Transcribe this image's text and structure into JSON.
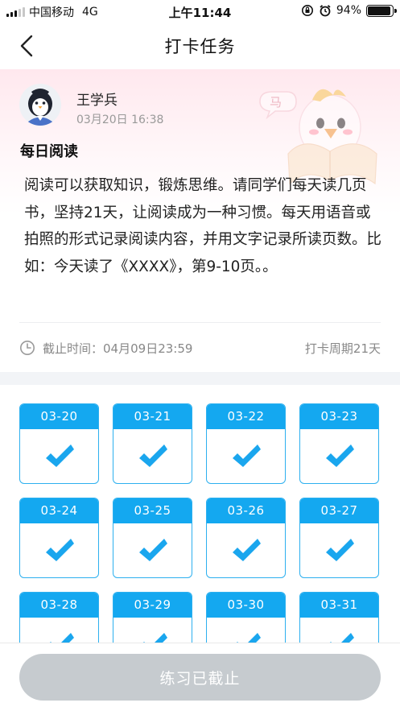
{
  "status_bar": {
    "carrier": "中国移动",
    "network": "4G",
    "time": "上午11:44",
    "battery_text": "94%",
    "battery_level": 0.94
  },
  "nav": {
    "title": "打卡任务",
    "back_icon": "chevron-left-icon"
  },
  "task": {
    "author": "王学兵",
    "post_time": "03月20日 16:38",
    "title": "每日阅读",
    "description": "阅读可以获取知识，锻炼思维。请同学们每天读几页书，坚持21天，让阅读成为一种习惯。每天用语音或拍照的形式记录阅读内容，并用文字记录所读页数。比如：今天读了《XXXX》，第9-10页。。",
    "deadline_label": "截止时间：",
    "deadline_value": "04月09日23:59",
    "cycle": "打卡周期21天"
  },
  "calendar": {
    "days": [
      {
        "date": "03-20",
        "checked": true
      },
      {
        "date": "03-21",
        "checked": true
      },
      {
        "date": "03-22",
        "checked": true
      },
      {
        "date": "03-23",
        "checked": true
      },
      {
        "date": "03-24",
        "checked": true
      },
      {
        "date": "03-25",
        "checked": true
      },
      {
        "date": "03-26",
        "checked": true
      },
      {
        "date": "03-27",
        "checked": true
      },
      {
        "date": "03-28",
        "checked": true
      },
      {
        "date": "03-29",
        "checked": true
      },
      {
        "date": "03-30",
        "checked": true
      },
      {
        "date": "03-31",
        "checked": true
      }
    ]
  },
  "footer": {
    "button_label": "练习已截止"
  },
  "colors": {
    "accent": "#14a8f0",
    "disabled_button": "#c6cbcf",
    "header_tint": "#ffe8ee"
  }
}
